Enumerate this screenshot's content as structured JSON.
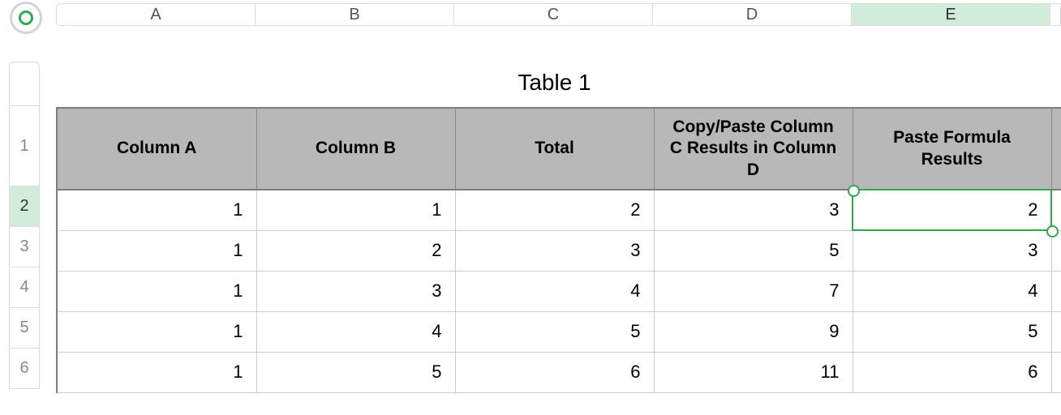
{
  "columns": {
    "A": "A",
    "B": "B",
    "C": "C",
    "D": "D",
    "E": "E"
  },
  "rows": {
    "r1": "1",
    "r2": "2",
    "r3": "3",
    "r4": "4",
    "r5": "5",
    "r6": "6"
  },
  "selected_col": "E",
  "selected_row": "2",
  "table": {
    "title": "Table 1",
    "headers": {
      "a": "Column A",
      "b": "Column B",
      "c": "Total",
      "d": "Copy/Paste Column C Results in Column D",
      "e": "Paste Formula Results"
    },
    "data": [
      {
        "a": "1",
        "b": "1",
        "c": "2",
        "d": "3",
        "e": "2"
      },
      {
        "a": "1",
        "b": "2",
        "c": "3",
        "d": "5",
        "e": "3"
      },
      {
        "a": "1",
        "b": "3",
        "c": "4",
        "d": "7",
        "e": "4"
      },
      {
        "a": "1",
        "b": "4",
        "c": "5",
        "d": "9",
        "e": "5"
      },
      {
        "a": "1",
        "b": "5",
        "c": "6",
        "d": "11",
        "e": "6"
      }
    ]
  },
  "chart_data": {
    "type": "table",
    "title": "Table 1",
    "columns": [
      "Column A",
      "Column B",
      "Total",
      "Copy/Paste Column C Results in Column D",
      "Paste Formula Results"
    ],
    "rows": [
      [
        1,
        1,
        2,
        3,
        2
      ],
      [
        1,
        2,
        3,
        5,
        3
      ],
      [
        1,
        3,
        4,
        7,
        4
      ],
      [
        1,
        4,
        5,
        9,
        5
      ],
      [
        1,
        5,
        6,
        11,
        6
      ]
    ]
  },
  "colors": {
    "accent": "#2fa84f",
    "header_fill": "#b8b8b8",
    "sel_fill": "#d2ecdb"
  }
}
